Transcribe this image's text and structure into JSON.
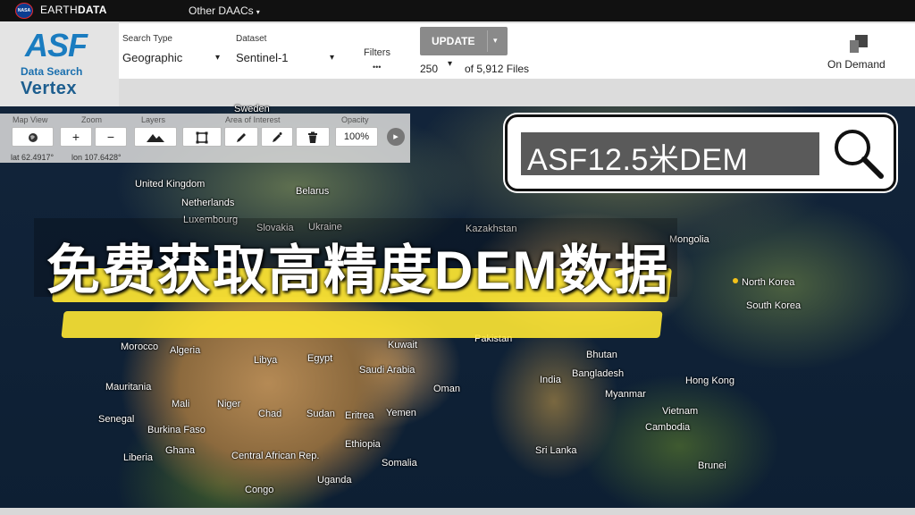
{
  "topbar": {
    "logo": "NASA",
    "brand_plain": "EARTH",
    "brand_bold": "DATA",
    "other_daacs": "Other DAACs",
    "caret": "▾"
  },
  "logo": {
    "asf": "ASF",
    "data_search": "Data Search",
    "vertex": "Vertex"
  },
  "header": {
    "search_type_label": "Search Type",
    "search_type_value": "Geographic",
    "dataset_label": "Dataset",
    "dataset_value": "Sentinel-1",
    "filters_label": "Filters",
    "filters_dots": "•••",
    "update_label": "UPDATE",
    "update_arrow": "▾",
    "max_results": "250",
    "results_count": "of 5,912 Files",
    "on_demand": "On Demand",
    "dropdown_arrow": "▾"
  },
  "toolbar": {
    "map_view": "Map View",
    "zoom": "Zoom",
    "layers": "Layers",
    "aoi": "Area of Interest",
    "opacity": "Opacity",
    "zoom_in": "+",
    "zoom_out": "−",
    "opacity_value": "100%",
    "lat": "lat 62.4917°",
    "lon": "lon 107.6428°"
  },
  "search_overlay": {
    "text": "ASF12.5米DEM"
  },
  "banner": {
    "title": "免费获取高精度DEM数据"
  },
  "countries": [
    {
      "name": "Sweden"
    },
    {
      "name": "United Kingdom"
    },
    {
      "name": "Belarus"
    },
    {
      "name": "Netherlands"
    },
    {
      "name": "Luxembourg"
    },
    {
      "name": "Slovakia"
    },
    {
      "name": "Ukraine"
    },
    {
      "name": "Kazakhstan"
    },
    {
      "name": "Mongolia"
    },
    {
      "name": "North Korea"
    },
    {
      "name": "South Korea"
    },
    {
      "name": "Morocco"
    },
    {
      "name": "Algeria"
    },
    {
      "name": "Libya"
    },
    {
      "name": "Egypt"
    },
    {
      "name": "Kuwait"
    },
    {
      "name": "Pakistan"
    },
    {
      "name": "Saudi Arabia"
    },
    {
      "name": "Oman"
    },
    {
      "name": "Bhutan"
    },
    {
      "name": "Bangladesh"
    },
    {
      "name": "India"
    },
    {
      "name": "Hong Kong"
    },
    {
      "name": "Myanmar"
    },
    {
      "name": "Mauritania"
    },
    {
      "name": "Mali"
    },
    {
      "name": "Niger"
    },
    {
      "name": "Chad"
    },
    {
      "name": "Sudan"
    },
    {
      "name": "Eritrea"
    },
    {
      "name": "Yemen"
    },
    {
      "name": "Vietnam"
    },
    {
      "name": "Senegal"
    },
    {
      "name": "Burkina Faso"
    },
    {
      "name": "Cambodia"
    },
    {
      "name": "Ethiopia"
    },
    {
      "name": "Ghana"
    },
    {
      "name": "Liberia"
    },
    {
      "name": "Central African Rep."
    },
    {
      "name": "Somalia"
    },
    {
      "name": "Sri Lanka"
    },
    {
      "name": "Brunei"
    },
    {
      "name": "Uganda"
    },
    {
      "name": "Congo"
    }
  ]
}
